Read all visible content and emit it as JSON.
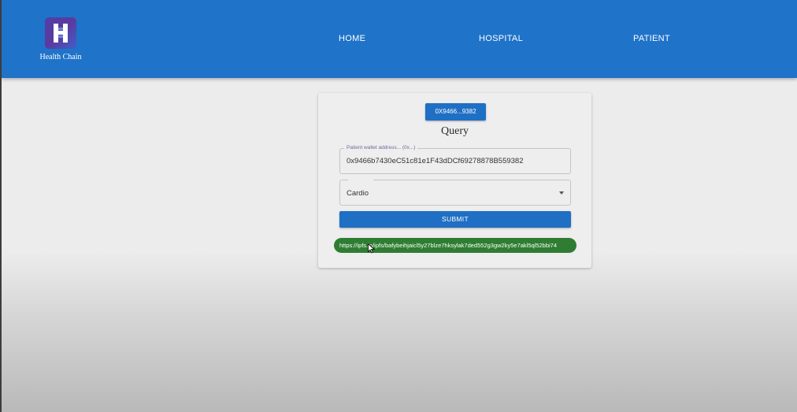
{
  "app": {
    "name": "Health Chain",
    "brand_color": "#1f73c9"
  },
  "nav": {
    "items": [
      {
        "label": "HOME"
      },
      {
        "label": "HOSPITAL"
      },
      {
        "label": "PATIENT"
      }
    ]
  },
  "card": {
    "account_button": "0X9466...9382",
    "title": "Query",
    "wallet_field": {
      "label": "Patient wallet address... (0x...)",
      "value": "0x9466b7430eC51c81e1F43dDCf69278878B559382"
    },
    "category_select": {
      "value": "Cardio"
    },
    "submit_label": "SUBMIT",
    "result_link": "https://ipfs.io/ipfs/bafybeihjaicl5y27blze7hksylak7ded552g3gw2ky5e7akl5ql52bbi74",
    "result_color": "#2f7d32"
  }
}
